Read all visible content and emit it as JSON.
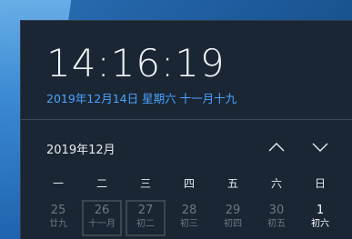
{
  "clock": {
    "time": "14:16:19",
    "date_line": "2019年12月14日 星期六 十一月十九"
  },
  "calendar": {
    "month_title": "2019年12月",
    "weekdays": [
      "一",
      "二",
      "三",
      "四",
      "五",
      "六",
      "日"
    ],
    "days": [
      {
        "num": "25",
        "lunar": "廿九"
      },
      {
        "num": "26",
        "lunar": "十一月"
      },
      {
        "num": "27",
        "lunar": "初二"
      },
      {
        "num": "28",
        "lunar": "初三"
      },
      {
        "num": "29",
        "lunar": "初四"
      },
      {
        "num": "30",
        "lunar": "初五"
      },
      {
        "num": "1",
        "lunar": "初六"
      }
    ]
  },
  "icons": {
    "prev_month": "chevron-up-icon",
    "next_month": "chevron-down-icon"
  },
  "colors": {
    "accent": "#4aa3ff",
    "panel_bg": "#1b2634",
    "dim_text": "#6d7884"
  }
}
